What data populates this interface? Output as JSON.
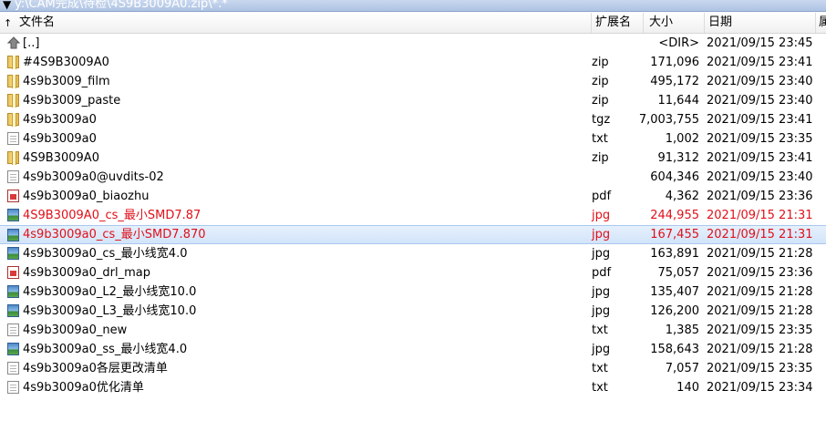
{
  "path_bar": {
    "dropdown_icon": "dropdown-arrow-icon",
    "path": "y:\\CAM完成\\待检\\4S9B3009A0.zip\\*.*"
  },
  "columns": {
    "name": "文件名",
    "ext": "扩展名",
    "size": "大小",
    "date": "日期",
    "attr": "属"
  },
  "rows": [
    {
      "name": "[..]",
      "ext": "",
      "size": "<DIR>",
      "date": "2021/09/15 23:45",
      "icon": "up-folder-icon"
    },
    {
      "name": "#4S9B3009A0",
      "ext": "zip",
      "size": "171,096",
      "date": "2021/09/15 23:41",
      "icon": "archive-icon"
    },
    {
      "name": "4s9b3009_film",
      "ext": "zip",
      "size": "495,172",
      "date": "2021/09/15 23:40",
      "icon": "archive-icon"
    },
    {
      "name": "4s9b3009_paste",
      "ext": "zip",
      "size": "11,644",
      "date": "2021/09/15 23:40",
      "icon": "archive-icon"
    },
    {
      "name": "4s9b3009a0",
      "ext": "tgz",
      "size": "7,003,755",
      "date": "2021/09/15 23:41",
      "icon": "archive-icon"
    },
    {
      "name": "4s9b3009a0",
      "ext": "txt",
      "size": "1,002",
      "date": "2021/09/15 23:35",
      "icon": "text-file-icon"
    },
    {
      "name": "4S9B3009A0",
      "ext": "zip",
      "size": "91,312",
      "date": "2021/09/15 23:41",
      "icon": "archive-icon"
    },
    {
      "name": "4s9b3009a0@uvdits-02",
      "ext": "",
      "size": "604,346",
      "date": "2021/09/15 23:40",
      "icon": "blank-file-icon"
    },
    {
      "name": "4s9b3009a0_biaozhu",
      "ext": "pdf",
      "size": "4,362",
      "date": "2021/09/15 23:36",
      "icon": "pdf-file-icon"
    },
    {
      "name": "4S9B3009A0_cs_最小SMD7.87",
      "ext": "jpg",
      "size": "244,955",
      "date": "2021/09/15 21:31",
      "icon": "image-file-icon",
      "marked": true
    },
    {
      "name": "4s9b3009a0_cs_最小SMD7.870",
      "ext": "jpg",
      "size": "167,455",
      "date": "2021/09/15 21:31",
      "icon": "image-file-icon",
      "marked": true,
      "selected": true
    },
    {
      "name": "4s9b3009a0_cs_最小线宽4.0",
      "ext": "jpg",
      "size": "163,891",
      "date": "2021/09/15 21:28",
      "icon": "image-file-icon"
    },
    {
      "name": "4s9b3009a0_drl_map",
      "ext": "pdf",
      "size": "75,057",
      "date": "2021/09/15 23:36",
      "icon": "pdf-file-icon"
    },
    {
      "name": "4s9b3009a0_L2_最小线宽10.0",
      "ext": "jpg",
      "size": "135,407",
      "date": "2021/09/15 21:28",
      "icon": "image-file-icon"
    },
    {
      "name": "4s9b3009a0_L3_最小线宽10.0",
      "ext": "jpg",
      "size": "126,200",
      "date": "2021/09/15 21:28",
      "icon": "image-file-icon"
    },
    {
      "name": "4s9b3009a0_new",
      "ext": "txt",
      "size": "1,385",
      "date": "2021/09/15 23:35",
      "icon": "text-file-icon"
    },
    {
      "name": "4s9b3009a0_ss_最小线宽4.0",
      "ext": "jpg",
      "size": "158,643",
      "date": "2021/09/15 21:28",
      "icon": "image-file-icon"
    },
    {
      "name": "4s9b3009a0各层更改清单",
      "ext": "txt",
      "size": "7,057",
      "date": "2021/09/15 23:35",
      "icon": "text-file-icon"
    },
    {
      "name": "4s9b3009a0优化清单",
      "ext": "txt",
      "size": "140",
      "date": "2021/09/15 23:34",
      "icon": "text-file-icon"
    }
  ],
  "colors": {
    "marked_text": "#e0101a",
    "selection": "#d3e4fa"
  }
}
